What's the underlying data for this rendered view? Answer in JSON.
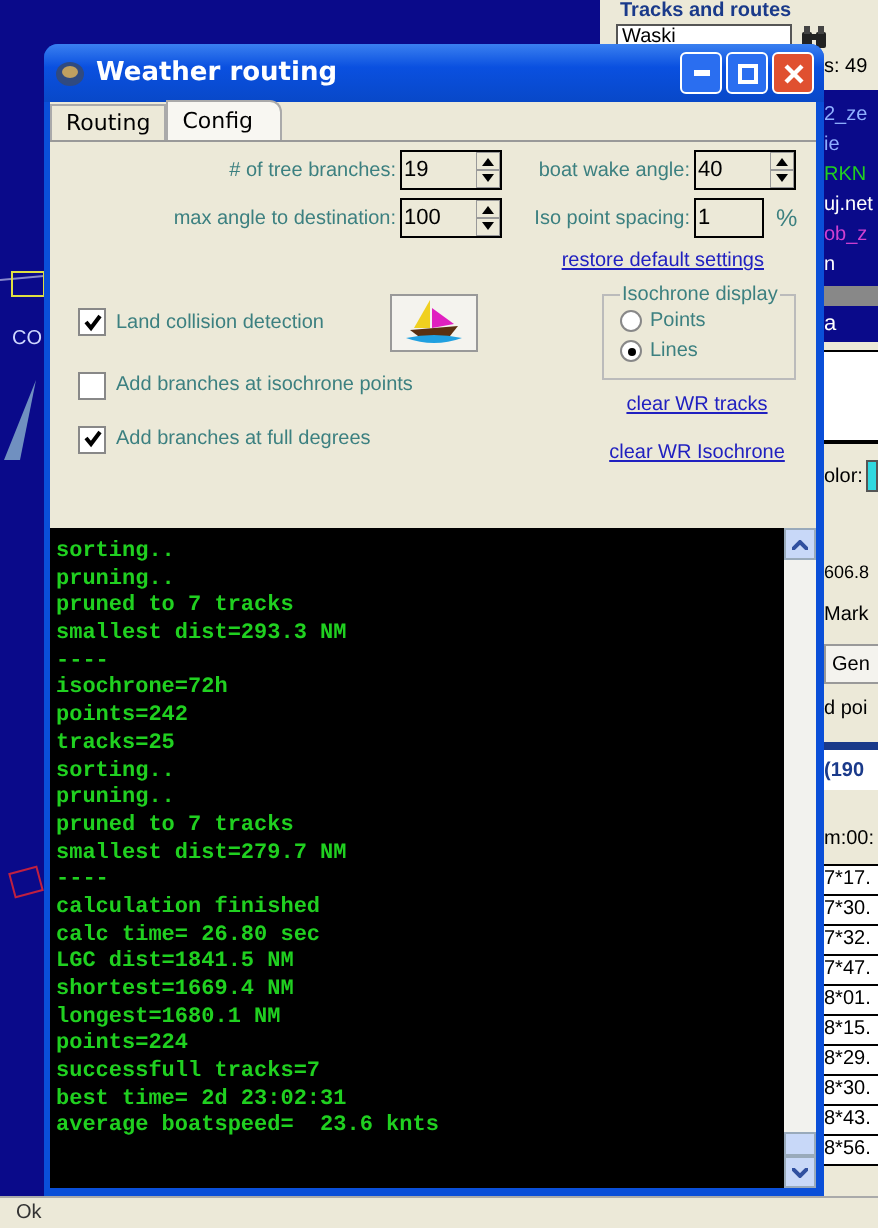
{
  "background_app": {
    "panel_title": "Tracks and routes",
    "track_field": "Waski",
    "list_fragments": [
      {
        "text": "s:  49",
        "kind": "light"
      },
      {
        "text": "2_ze",
        "color": "#8fb0ff"
      },
      {
        "text": "ie",
        "color": "#8fb0ff"
      },
      {
        "text": "RKN",
        "color": "#20d020"
      },
      {
        "text": "uj.net",
        "color": "#ffffff"
      },
      {
        "text": "ob_z",
        "color": "#d040d0"
      },
      {
        "text": "n",
        "color": "#ffffff"
      }
    ],
    "selected_fragment": "a",
    "color_label": "olor:",
    "distance": "606.8",
    "mark_label": "Mark",
    "general_button": "Gen",
    "points_label": "d poi",
    "heading": "(190",
    "time_label": "m:00:",
    "coordinates": [
      "7*17.",
      "7*30.",
      "7*32.",
      "7*47.",
      "8*01.",
      "8*15.",
      "8*29.",
      "8*30.",
      "8*43.",
      "8*56."
    ],
    "map_label": "CO",
    "status": "Ok"
  },
  "window": {
    "title": "Weather routing",
    "tabs": [
      {
        "label": "Routing",
        "selected": false
      },
      {
        "label": "Config",
        "selected": true
      }
    ],
    "spinners_left": [
      {
        "label": "# of tree branches:",
        "value": "19"
      },
      {
        "label": "max angle to destination:",
        "value": "100"
      }
    ],
    "spinners_right": [
      {
        "label": "boat wake angle:",
        "value": "40",
        "kind": "spin"
      },
      {
        "label": "Iso point spacing:",
        "value": "1",
        "unit": "%",
        "kind": "plain"
      }
    ],
    "restore_link": "restore default settings",
    "checkboxes": [
      {
        "label": "Land collision detection",
        "checked": true
      },
      {
        "label": "Add branches at isochrone points",
        "checked": false
      },
      {
        "label": "Add branches at full degrees",
        "checked": true
      }
    ],
    "isochrone_display": {
      "title": "Isochrone display",
      "options": [
        {
          "label": "Points",
          "selected": false
        },
        {
          "label": "Lines",
          "selected": true
        }
      ]
    },
    "links": [
      "clear WR tracks",
      "clear WR  Isochrone"
    ],
    "log": [
      "sorting..",
      "pruning..",
      "pruned to 7 tracks",
      "smallest dist=293.3 NM",
      "----",
      "isochrone=72h",
      "points=242",
      "tracks=25",
      "sorting..",
      "pruning..",
      "pruned to 7 tracks",
      "smallest dist=279.7 NM",
      "----",
      "calculation finished",
      "calc time= 26.80 sec",
      "LGC dist=1841.5 NM",
      "shortest=1669.4 NM",
      "longest=1680.1 NM",
      "points=224",
      "successfull tracks=7",
      "best time= 2d 23:02:31",
      "average boatspeed=  23.6 knts"
    ]
  }
}
